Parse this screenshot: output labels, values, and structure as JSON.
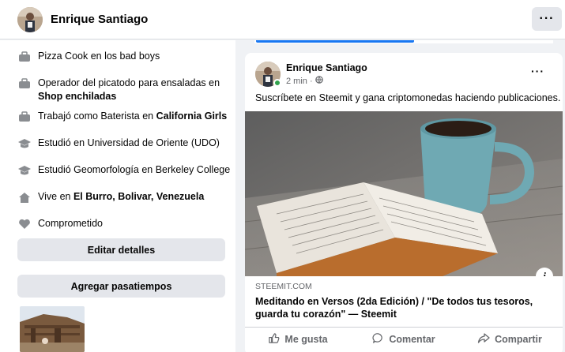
{
  "header": {
    "profile_name": "Enrique Santiago",
    "more_label": "···"
  },
  "details": [
    {
      "icon": "briefcase-icon",
      "text": "Pizza Cook en los bad boys",
      "bold": ""
    },
    {
      "icon": "briefcase-icon",
      "text": "Operador del picatodo para ensaladas en ",
      "bold": "Shop enchiladas"
    },
    {
      "icon": "briefcase-icon",
      "text": "Trabajó como Baterista en ",
      "bold": "California Girls"
    },
    {
      "icon": "graduation-cap-icon",
      "text": "Estudió en Universidad de Oriente (UDO)",
      "bold": ""
    },
    {
      "icon": "graduation-cap-icon",
      "text": "Estudió Geomorfología en Berkeley College",
      "bold": ""
    },
    {
      "icon": "home-icon",
      "text": "Vive en ",
      "bold": "El Burro, Bolivar, Venezuela"
    },
    {
      "icon": "heart-icon",
      "text": "Comprometido",
      "bold": ""
    }
  ],
  "buttons": {
    "edit_details": "Editar detalles",
    "add_hobbies": "Agregar pasatiempos"
  },
  "post": {
    "author": "Enrique Santiago",
    "time": "2 min ·",
    "more_label": "···",
    "text": "Suscríbete en Steemit y gana criptomonedas haciendo publicaciones.",
    "link_domain": "STEEMIT.COM",
    "link_title": "Meditando en Versos (2da Edición) / \"De todos tus tesoros, guarda tu corazón\" — Steemit",
    "info_label": "i"
  },
  "actions": {
    "like": "Me gusta",
    "comment": "Comentar",
    "share": "Compartir"
  },
  "colors": {
    "accent": "#1877f2",
    "button_gray": "#e4e6eb",
    "online": "#31a24c",
    "secondary_text": "#65676b"
  }
}
